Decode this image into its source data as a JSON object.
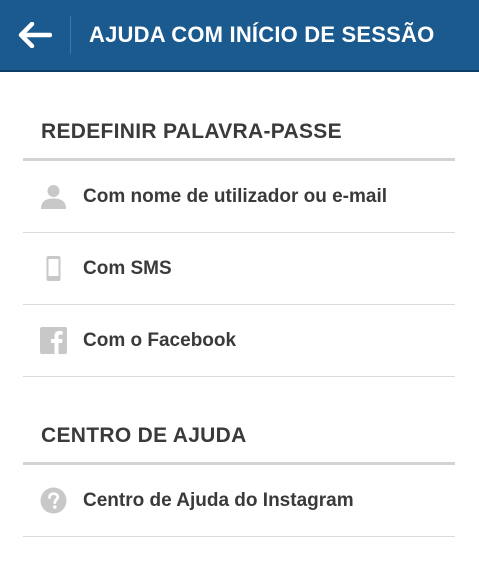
{
  "header": {
    "title": "AJUDA COM INÍCIO DE SESSÃO"
  },
  "sections": [
    {
      "title": "REDEFINIR PALAVRA-PASSE",
      "items": [
        {
          "icon": "user-icon",
          "label": "Com nome de utilizador ou e-mail"
        },
        {
          "icon": "phone-icon",
          "label": "Com SMS"
        },
        {
          "icon": "facebook-icon",
          "label": "Com o Facebook"
        }
      ]
    },
    {
      "title": "CENTRO DE AJUDA",
      "items": [
        {
          "icon": "help-icon",
          "label": "Centro de Ajuda do Instagram"
        }
      ]
    }
  ],
  "colors": {
    "app_bar": "#1a5a8e",
    "text": "#3a3a3a",
    "icon": "#c8c8c8",
    "divider": "#d3d3d3"
  }
}
